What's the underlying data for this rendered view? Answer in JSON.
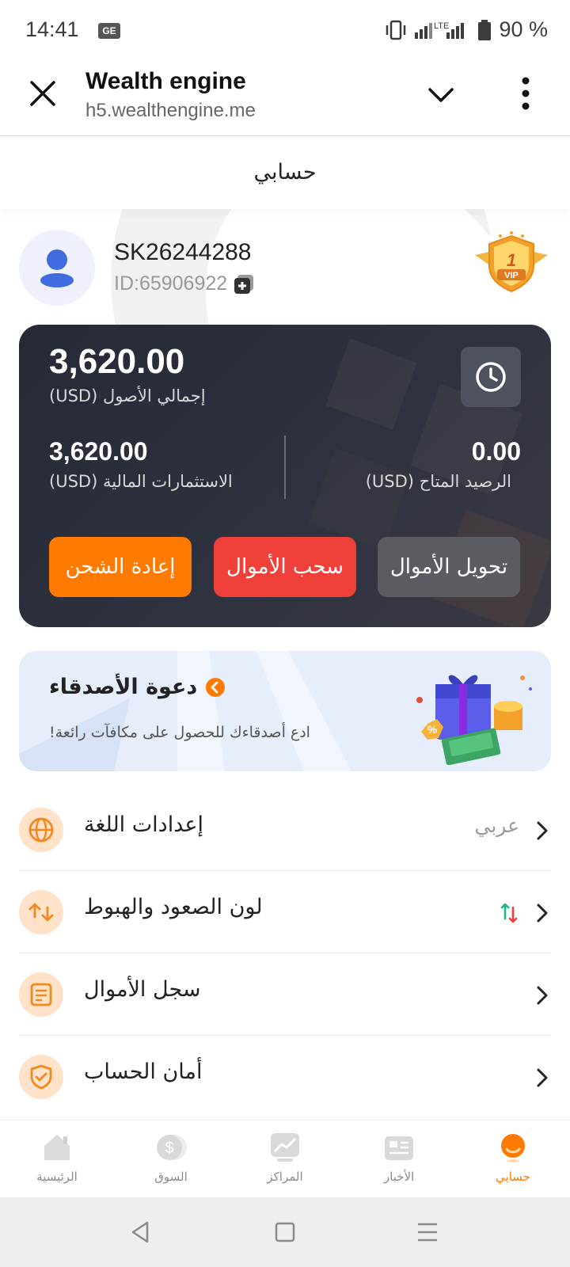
{
  "status_bar": {
    "time": "14:41",
    "carrier_icon": "ge",
    "network": "LTE",
    "battery": "90 %"
  },
  "browser": {
    "title": "Wealth engine",
    "url": "h5.wealthengine.me"
  },
  "page": {
    "title": "حسابي"
  },
  "profile": {
    "username": "SK26244288",
    "user_id": "ID:65906922",
    "vip_level": "1",
    "vip_label": "VIP"
  },
  "balance_card": {
    "total_assets_value": "3,620.00",
    "total_assets_label": "إجمالي الأصول  (USD)",
    "investments_value": "3,620.00",
    "investments_label": "الاستثمارات المالية  (USD)",
    "available_value": "0.00",
    "available_label": "الرصيد المتاح  (USD)",
    "recharge_label": "إعادة الشحن",
    "withdraw_label": "سحب الأموال",
    "transfer_label": "تحويل الأموال"
  },
  "invite": {
    "title": "دعوة الأصدقاء",
    "subtitle": "ادع أصدقاءك للحصول على مكافآت رائعة!"
  },
  "settings": {
    "language_label": "إعدادات اللغة",
    "language_value": "عربي",
    "color_label": "لون الصعود والهبوط",
    "funds_record_label": "سجل الأموال",
    "security_label": "أمان الحساب"
  },
  "tabs": {
    "home": "الرئيسية",
    "market": "السوق",
    "positions": "المراكز",
    "news": "الأخبار",
    "account": "حسابي"
  },
  "colors": {
    "accent": "#ff7a00",
    "withdraw": "#f0403a",
    "transfer": "#5b5c62",
    "card_bg": "#262a36",
    "up": "#1db58a",
    "down": "#f0403a"
  }
}
